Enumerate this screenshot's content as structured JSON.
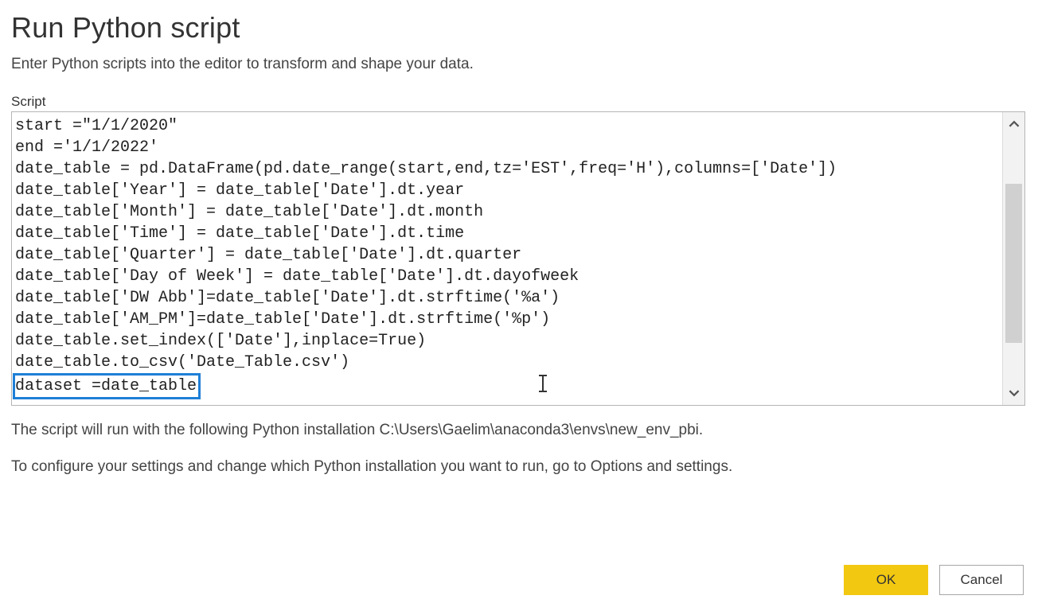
{
  "dialog": {
    "title": "Run Python script",
    "subtitle": "Enter Python scripts into the editor to transform and shape your data.",
    "script_label": "Script",
    "script_lines": [
      "start =\"1/1/2020\"",
      "end ='1/1/2022'",
      "date_table = pd.DataFrame(pd.date_range(start,end,tz='EST',freq='H'),columns=['Date'])",
      "date_table['Year'] = date_table['Date'].dt.year",
      "date_table['Month'] = date_table['Date'].dt.month",
      "date_table['Time'] = date_table['Date'].dt.time",
      "date_table['Quarter'] = date_table['Date'].dt.quarter",
      "date_table['Day of Week'] = date_table['Date'].dt.dayofweek",
      "date_table['DW Abb']=date_table['Date'].dt.strftime('%a')",
      "date_table['AM_PM']=date_table['Date'].dt.strftime('%p')",
      "date_table.set_index(['Date'],inplace=True)",
      "date_table.to_csv('Date_Table.csv')"
    ],
    "script_last_line": "dataset =date_table",
    "info_line_1": "The script will run with the following Python installation C:\\Users\\Gaelim\\anaconda3\\envs\\new_env_pbi.",
    "info_line_2": "To configure your settings and change which Python installation you want to run, go to Options and settings.",
    "ok_label": "OK",
    "cancel_label": "Cancel"
  },
  "colors": {
    "accent": "#f2c811",
    "highlight_border": "#1e7fd6"
  }
}
